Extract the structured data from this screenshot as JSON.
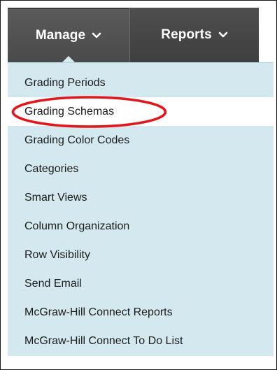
{
  "tabs": {
    "manage_label": "Manage",
    "reports_label": "Reports"
  },
  "menu": {
    "items": [
      {
        "label": "Grading Periods"
      },
      {
        "label": "Grading Schemas",
        "selected": true
      },
      {
        "label": "Grading Color Codes"
      },
      {
        "label": "Categories"
      },
      {
        "label": "Smart Views"
      },
      {
        "label": "Column Organization"
      },
      {
        "label": "Row Visibility"
      },
      {
        "label": "Send Email"
      },
      {
        "label": "McGraw-Hill Connect Reports"
      },
      {
        "label": "McGraw-Hill Connect To Do List"
      }
    ]
  },
  "colors": {
    "tab_bg": "#4a4a4a",
    "menu_bg": "#d3e9ef",
    "highlight_ellipse": "#e2161b"
  },
  "icons": {
    "tab_arrow": "chevron-down-icon",
    "annotation": "red-ellipse-highlight"
  }
}
